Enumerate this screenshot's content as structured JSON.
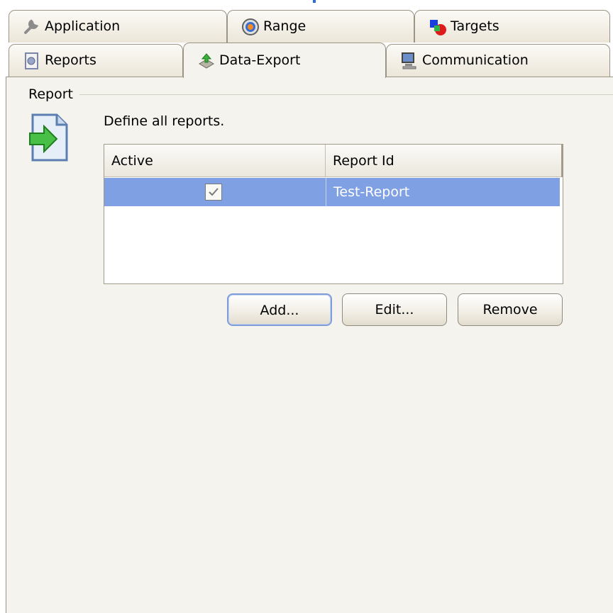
{
  "tabs_row1": [
    {
      "label": "Application",
      "icon": "wrench-icon"
    },
    {
      "label": "Range",
      "icon": "target-icon"
    },
    {
      "label": "Targets",
      "icon": "shapes-icon"
    }
  ],
  "tabs_row2": [
    {
      "label": "Reports",
      "icon": "report-gear-icon"
    },
    {
      "label": "Data-Export",
      "icon": "data-export-icon",
      "active": true
    },
    {
      "label": "Communication",
      "icon": "computer-icon"
    }
  ],
  "group": {
    "label": "Report"
  },
  "description": "Define all reports.",
  "table": {
    "columns": [
      "Active",
      "Report Id"
    ],
    "rows": [
      {
        "active": true,
        "report_id": "Test-Report",
        "selected": true
      }
    ]
  },
  "buttons": {
    "add": "Add...",
    "edit": "Edit...",
    "remove": "Remove"
  },
  "colors": {
    "selection": "#7fa0e2",
    "panel": "#f5f3ee",
    "tab_border": "#9c9485"
  }
}
